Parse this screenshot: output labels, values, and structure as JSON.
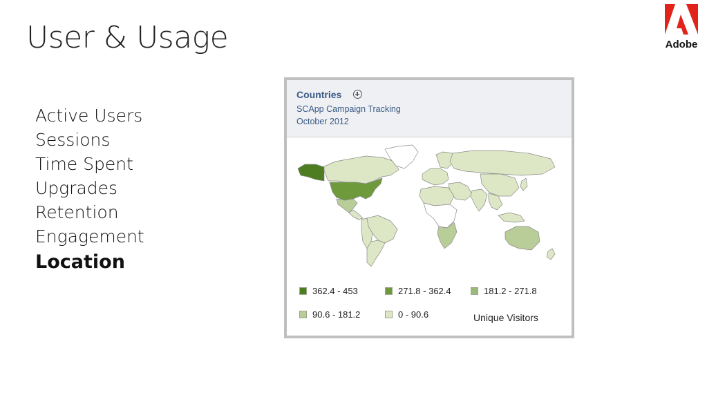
{
  "slide": {
    "title": "User & Usage"
  },
  "brand": {
    "logo_text": "Adobe",
    "logo_color": "#e1231a"
  },
  "topics": [
    {
      "label": "Active Users",
      "active": false
    },
    {
      "label": "Sessions",
      "active": false
    },
    {
      "label": "Time Spent",
      "active": false
    },
    {
      "label": "Upgrades",
      "active": false
    },
    {
      "label": "Retention",
      "active": false
    },
    {
      "label": "Engagement",
      "active": false
    },
    {
      "label": "Location",
      "active": true
    }
  ],
  "report": {
    "title": "Countries",
    "subtitle": "SCApp Campaign Tracking",
    "period": "October 2012",
    "metric": "Unique Visitors",
    "legend": [
      {
        "label": "362.4 - 453",
        "color": "#4e7d21"
      },
      {
        "label": "271.8 - 362.4",
        "color": "#6f9a3b"
      },
      {
        "label": "181.2 - 271.8",
        "color": "#9ab877"
      },
      {
        "label": "90.6 - 181.2",
        "color": "#b9cd99"
      },
      {
        "label": "0 - 90.6",
        "color": "#dde7c5"
      }
    ],
    "map_regions": [
      {
        "name": "Alaska",
        "bin": 0
      },
      {
        "name": "United States",
        "bin": 1
      },
      {
        "name": "Canada",
        "bin": 4
      },
      {
        "name": "Greenland",
        "bin": null
      },
      {
        "name": "Mexico",
        "bin": 3
      },
      {
        "name": "Central America",
        "bin": 4
      },
      {
        "name": "Brazil",
        "bin": 4
      },
      {
        "name": "Argentina",
        "bin": 4
      },
      {
        "name": "Andes",
        "bin": 4
      },
      {
        "name": "Western Europe",
        "bin": 4
      },
      {
        "name": "Scandinavia",
        "bin": 4
      },
      {
        "name": "North Africa",
        "bin": 4
      },
      {
        "name": "Central Africa",
        "bin": null
      },
      {
        "name": "Southern Africa",
        "bin": 3
      },
      {
        "name": "Russia",
        "bin": 4
      },
      {
        "name": "Middle East",
        "bin": 4
      },
      {
        "name": "India",
        "bin": 4
      },
      {
        "name": "China",
        "bin": 4
      },
      {
        "name": "Southeast Asia",
        "bin": 4
      },
      {
        "name": "Japan",
        "bin": 4
      },
      {
        "name": "Indonesia",
        "bin": 4
      },
      {
        "name": "Australia",
        "bin": 3
      },
      {
        "name": "New Zealand",
        "bin": 4
      }
    ]
  }
}
